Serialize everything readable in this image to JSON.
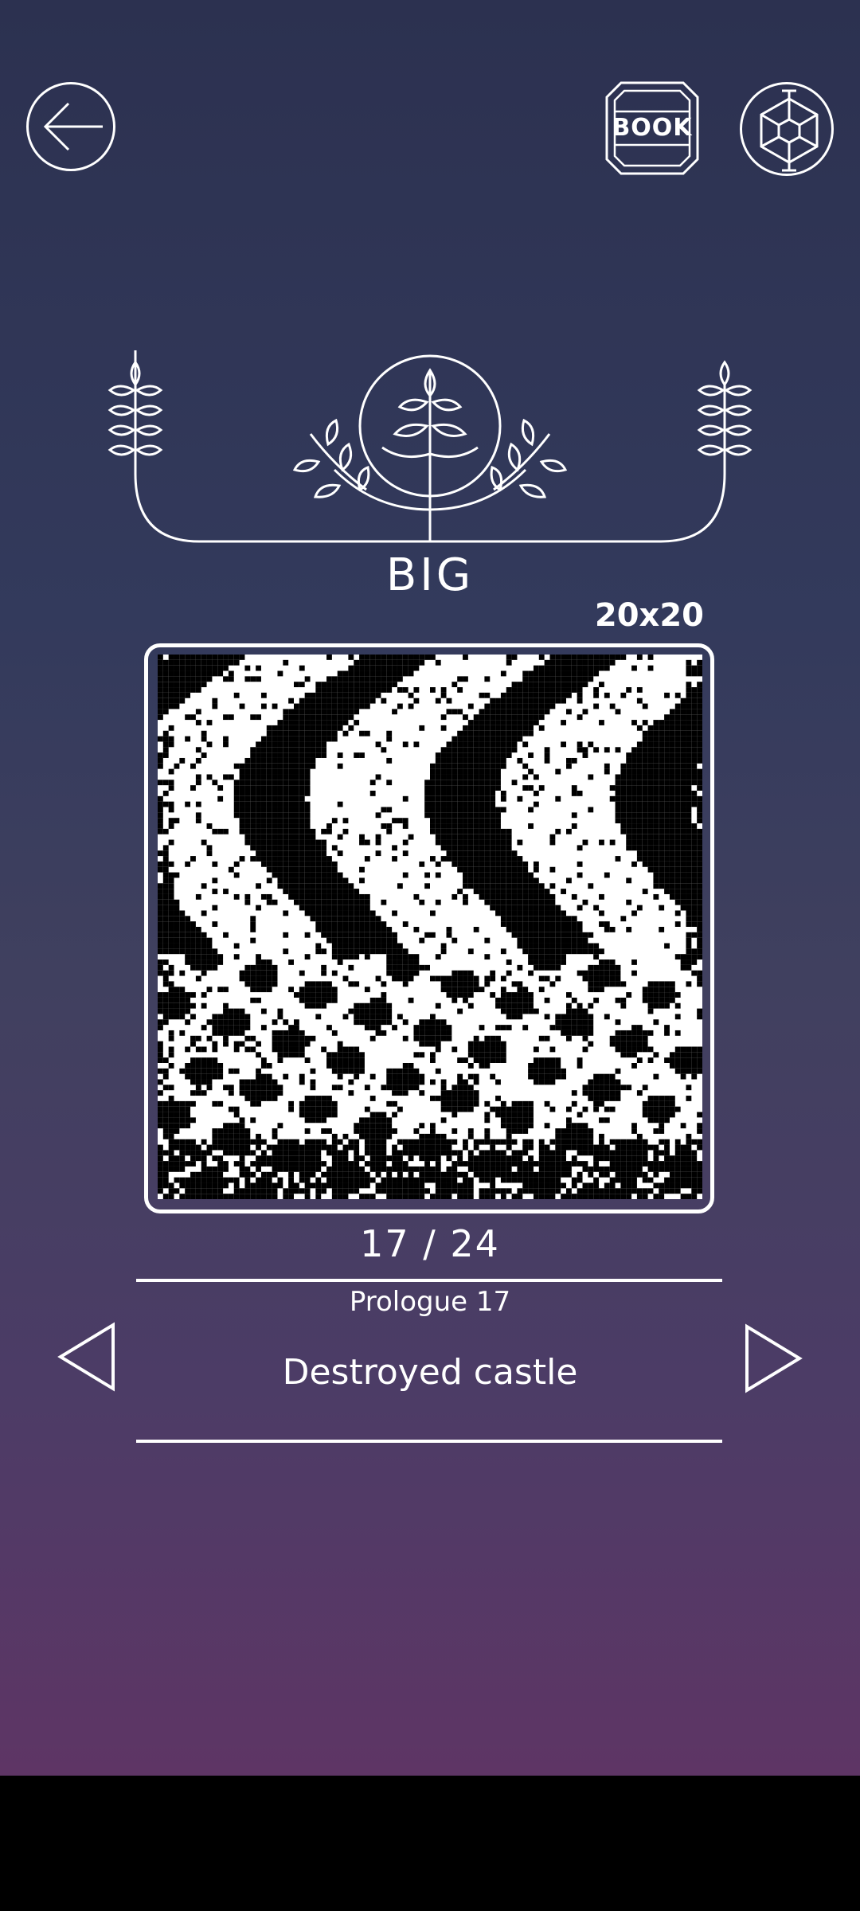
{
  "header": {
    "back_icon": "arrow-left-icon",
    "book_label": "BOOK",
    "settings_icon": "hexagon-gear-icon"
  },
  "category": {
    "emblem_icon": "laurel-sprout-emblem-icon",
    "title": "BIG",
    "grid_size": "20x20"
  },
  "puzzle": {
    "image": "pixel-art-destroyed-castle",
    "progress": "17 / 24",
    "chapter": "Prologue 17",
    "name": "Destroyed castle",
    "prev_icon": "triangle-left-icon",
    "next_icon": "triangle-right-icon"
  },
  "colors": {
    "background_top": "#2c3150",
    "background_bottom": "#5e3565",
    "foreground": "#ffffff"
  }
}
